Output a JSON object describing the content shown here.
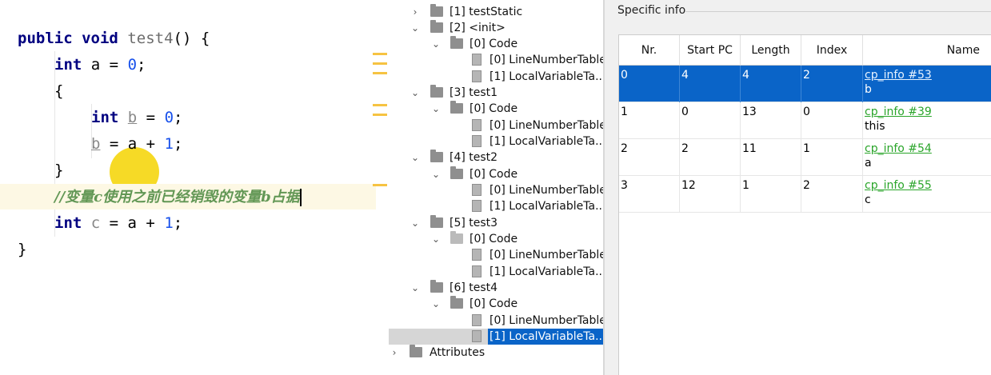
{
  "editor": {
    "lines": {
      "l1": {
        "kw1": "public",
        "kw2": "void",
        "name": "test4",
        "rest": "() {"
      },
      "l2": {
        "kw": "int",
        "var": "a",
        "eq": " = ",
        "val": "0",
        "end": ";"
      },
      "l3": {
        "text": "{"
      },
      "l4": {
        "kw": "int",
        "var": "b",
        "eq": " = ",
        "val": "0",
        "end": ";"
      },
      "l5": {
        "var": "b",
        "mid": " = a + ",
        "val": "1",
        "end": ";"
      },
      "l6": {
        "text": "}"
      },
      "l7": {
        "comment": "//变量c使用之前已经销毁的变量b占据"
      },
      "l8": {
        "kw": "int",
        "var": "c",
        "mid": " = a + ",
        "val": "1",
        "end": ";"
      },
      "l9": {
        "text": "}"
      }
    }
  },
  "tree": {
    "items": [
      {
        "label": "[1] testStatic"
      },
      {
        "label": "[2] <init>"
      },
      {
        "label": "[0] Code"
      },
      {
        "label": "[0] LineNumberTable"
      },
      {
        "label": "[1] LocalVariableTa..."
      },
      {
        "label": "[3] test1"
      },
      {
        "label": "[0] Code"
      },
      {
        "label": "[0] LineNumberTable"
      },
      {
        "label": "[1] LocalVariableTa..."
      },
      {
        "label": "[4] test2"
      },
      {
        "label": "[0] Code"
      },
      {
        "label": "[0] LineNumberTable"
      },
      {
        "label": "[1] LocalVariableTa..."
      },
      {
        "label": "[5] test3"
      },
      {
        "label": "[0] Code"
      },
      {
        "label": "[0] LineNumberTable"
      },
      {
        "label": "[1] LocalVariableTa..."
      },
      {
        "label": "[6] test4"
      },
      {
        "label": "[0] Code"
      },
      {
        "label": "[0] LineNumberTable"
      },
      {
        "label": "[1] LocalVariableTa..."
      },
      {
        "label": "Attributes"
      }
    ]
  },
  "info": {
    "title": "Specific info",
    "columns": [
      "Nr.",
      "Start PC",
      "Length",
      "Index",
      "Name"
    ],
    "rows": [
      {
        "nr": "0",
        "start": "4",
        "length": "4",
        "index": "2",
        "link": "cp_info #53",
        "name": "b"
      },
      {
        "nr": "1",
        "start": "0",
        "length": "13",
        "index": "0",
        "link": "cp_info #39",
        "name": "this"
      },
      {
        "nr": "2",
        "start": "2",
        "length": "11",
        "index": "1",
        "link": "cp_info #54",
        "name": "a"
      },
      {
        "nr": "3",
        "start": "12",
        "length": "1",
        "index": "2",
        "link": "cp_info #55",
        "name": "c"
      }
    ]
  },
  "colors": {
    "selection": "#0a64c8",
    "link": "#2aa52a",
    "keyword": "#000080",
    "number": "#1750eb",
    "comment": "#629755"
  }
}
